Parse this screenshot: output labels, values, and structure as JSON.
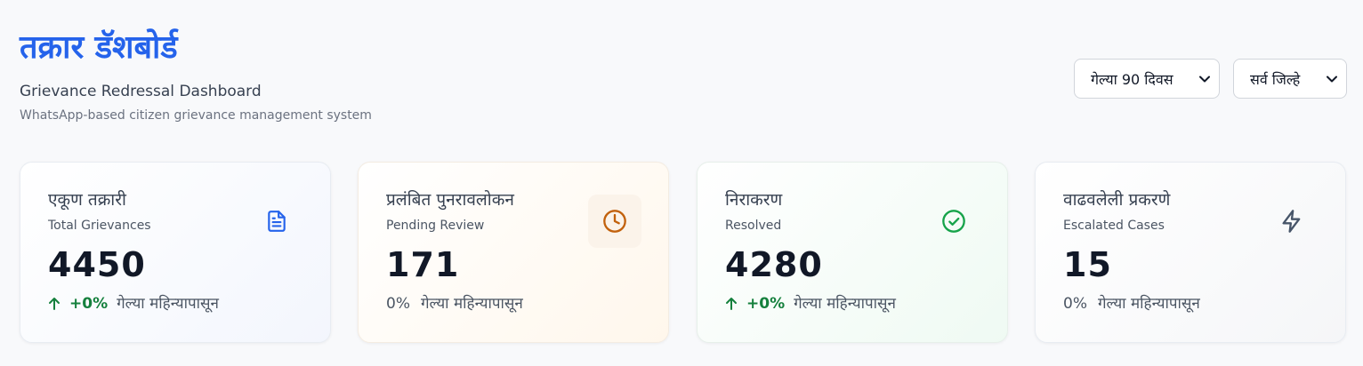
{
  "header": {
    "title": "तक्रार डॅशबोर्ड",
    "subtitle": "Grievance Redressal Dashboard",
    "description": "WhatsApp-based citizen grievance management system"
  },
  "filters": {
    "period": "गेल्या 90 दिवस",
    "district": "सर्व जिल्हे"
  },
  "cards": [
    {
      "label": "एकूण तक्रारी",
      "sublabel": "Total Grievances",
      "value": "4450",
      "change": "+0%",
      "trend": "up",
      "period_text": "गेल्या महिन्यापासून",
      "icon": "document-icon",
      "color": "#2563eb"
    },
    {
      "label": "प्रलंबित पुनरावलोकन",
      "sublabel": "Pending Review",
      "value": "171",
      "change": "0%",
      "trend": "flat",
      "period_text": "गेल्या महिन्यापासून",
      "icon": "clock-icon",
      "color": "#c2610c"
    },
    {
      "label": "निराकरण",
      "sublabel": "Resolved",
      "value": "4280",
      "change": "+0%",
      "trend": "up",
      "period_text": "गेल्या महिन्यापासून",
      "icon": "check-circle-icon",
      "color": "#16a34a"
    },
    {
      "label": "वाढवलेली प्रकरणे",
      "sublabel": "Escalated Cases",
      "value": "15",
      "change": "0%",
      "trend": "flat",
      "period_text": "गेल्या महिन्यापासून",
      "icon": "lightning-icon",
      "color": "#475569"
    }
  ]
}
